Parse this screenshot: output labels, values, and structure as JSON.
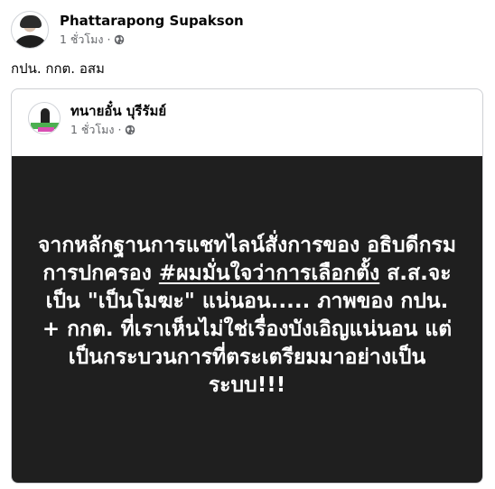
{
  "post": {
    "author": "Phattarapong Supakson",
    "time": "1 ชั่วโมง",
    "separator": "·",
    "audience_icon": "globe-icon",
    "text": "กปน. กกต. อสม"
  },
  "shared_post": {
    "author": "ทนายอั๋น บุรีรัมย์",
    "time": "1 ชั่วโมง",
    "separator": "·",
    "audience_icon": "globe-icon",
    "image_text": {
      "part1": "จากหลักฐานการแชทไลน์สั่งการของ อธิบดีกรมการปกครอง ",
      "hashtag": "#ผมมั่นใจว่าการเลือกตั้ง",
      "part2": " ส.ส.จะเป็น \"เป็นโมฆะ\" แน่นอน..... ภาพของ กปน. + กกต. ที่เราเห็นไม่ใช่เรื่องบังเอิญแน่นอน แต่เป็นกระบวนการที่ตระเตรียมมาอย่างเป็นระบบ!!!"
    }
  },
  "colors": {
    "text_primary": "#050505",
    "text_secondary": "#65676b",
    "card_border": "#ced0d4",
    "panel_bg": "#1f1f1f",
    "panel_text": "#ffffff"
  }
}
